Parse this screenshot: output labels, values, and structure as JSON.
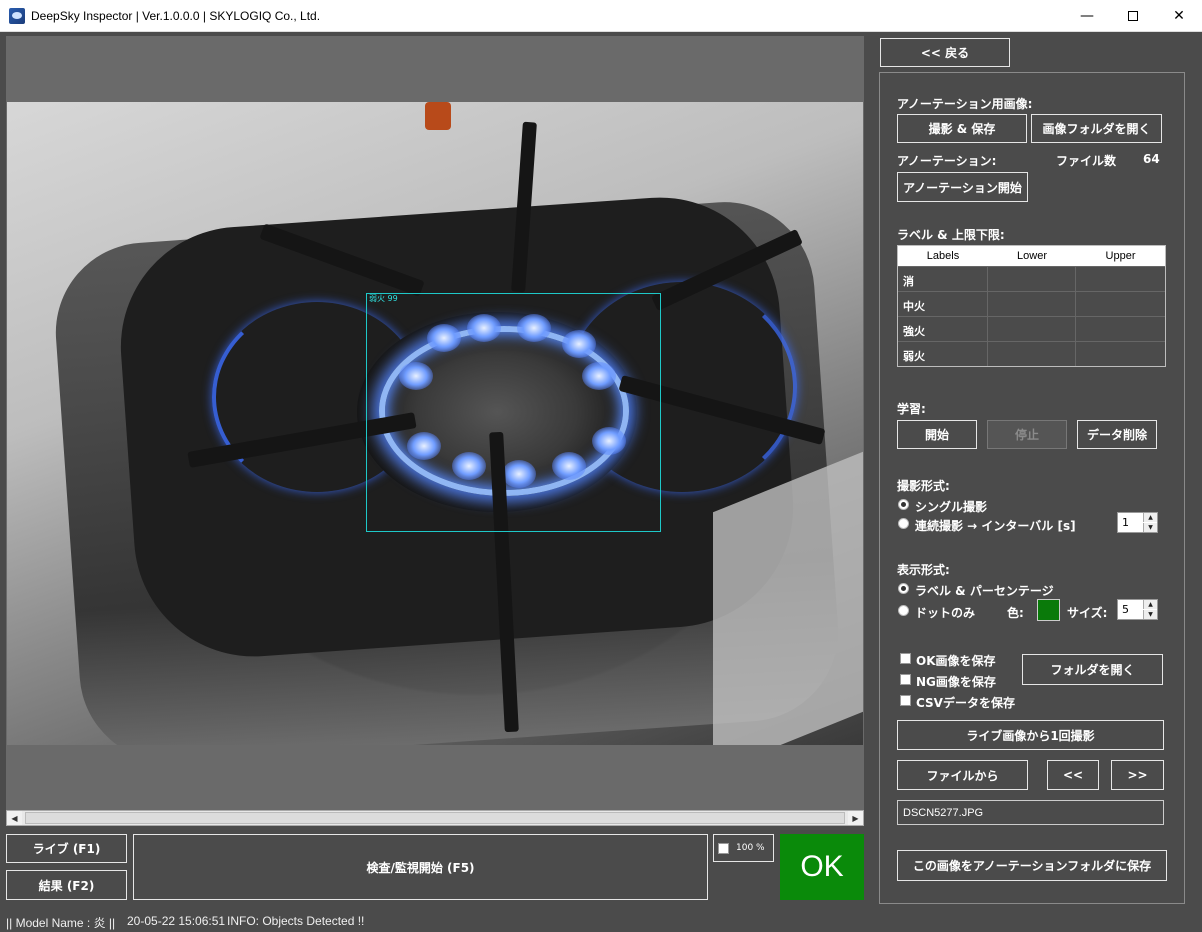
{
  "window": {
    "title": "DeepSky Inspector | Ver.1.0.0.0 | SKYLOGIQ Co., Ltd.",
    "minimize": "—",
    "close": "✕"
  },
  "viewer": {
    "detection_label": "弱火 99"
  },
  "bottom": {
    "live_button": "ライブ (F1)",
    "result_button": "結果 (F2)",
    "inspect_button": "検査/監視開始 (F5)",
    "zoom_label": "100 %",
    "result_badge": "OK"
  },
  "status": {
    "model": "|| Model Name : 炎 ||",
    "timestamp": "20-05-22 15:06:51",
    "info": "INFO:   Objects Detected !!"
  },
  "panel": {
    "back_button": "<< 戻る",
    "annotation_images_label": "アノーテーション用画像:",
    "capture_save_button": "撮影 & 保存",
    "open_image_folder_button": "画像フォルダを開く",
    "annotation_label": "アノーテーション:",
    "file_count_label": "ファイル数",
    "file_count_value": "64",
    "start_annotation_button": "アノーテーション開始",
    "labels_limits_label": "ラベル & 上限下限:",
    "table": {
      "headers": [
        "Labels",
        "Lower",
        "Upper"
      ],
      "rows": [
        {
          "label": "消",
          "lower": "",
          "upper": ""
        },
        {
          "label": "中火",
          "lower": "",
          "upper": ""
        },
        {
          "label": "強火",
          "lower": "",
          "upper": ""
        },
        {
          "label": "弱火",
          "lower": "",
          "upper": ""
        }
      ]
    },
    "learning_label": "学習:",
    "start_button": "開始",
    "stop_button": "停止",
    "delete_data_button": "データ削除",
    "capture_mode_label": "撮影形式:",
    "single_capture": "シングル撮影",
    "continuous_capture": "連続撮影 → インターバル [s]",
    "interval_value": "1",
    "display_mode_label": "表示形式:",
    "label_percentage": "ラベル & パーセンテージ",
    "dots_only": "ドットのみ",
    "color_label": "色:",
    "dot_color": "#0a7a0a",
    "size_label": "サイズ:",
    "size_value": "5",
    "save_ok": "OK画像を保存",
    "save_ng": "NG画像を保存",
    "save_csv": "CSVデータを保存",
    "open_folder_button": "フォルダを開く",
    "capture_once_button": "ライブ画像から1回撮影",
    "from_file_button": "ファイルから",
    "prev_button": "<<",
    "next_button": ">>",
    "filename": "DSCN5277.JPG",
    "save_to_annotation_button": "この画像をアノーテーションフォルダに保存"
  }
}
